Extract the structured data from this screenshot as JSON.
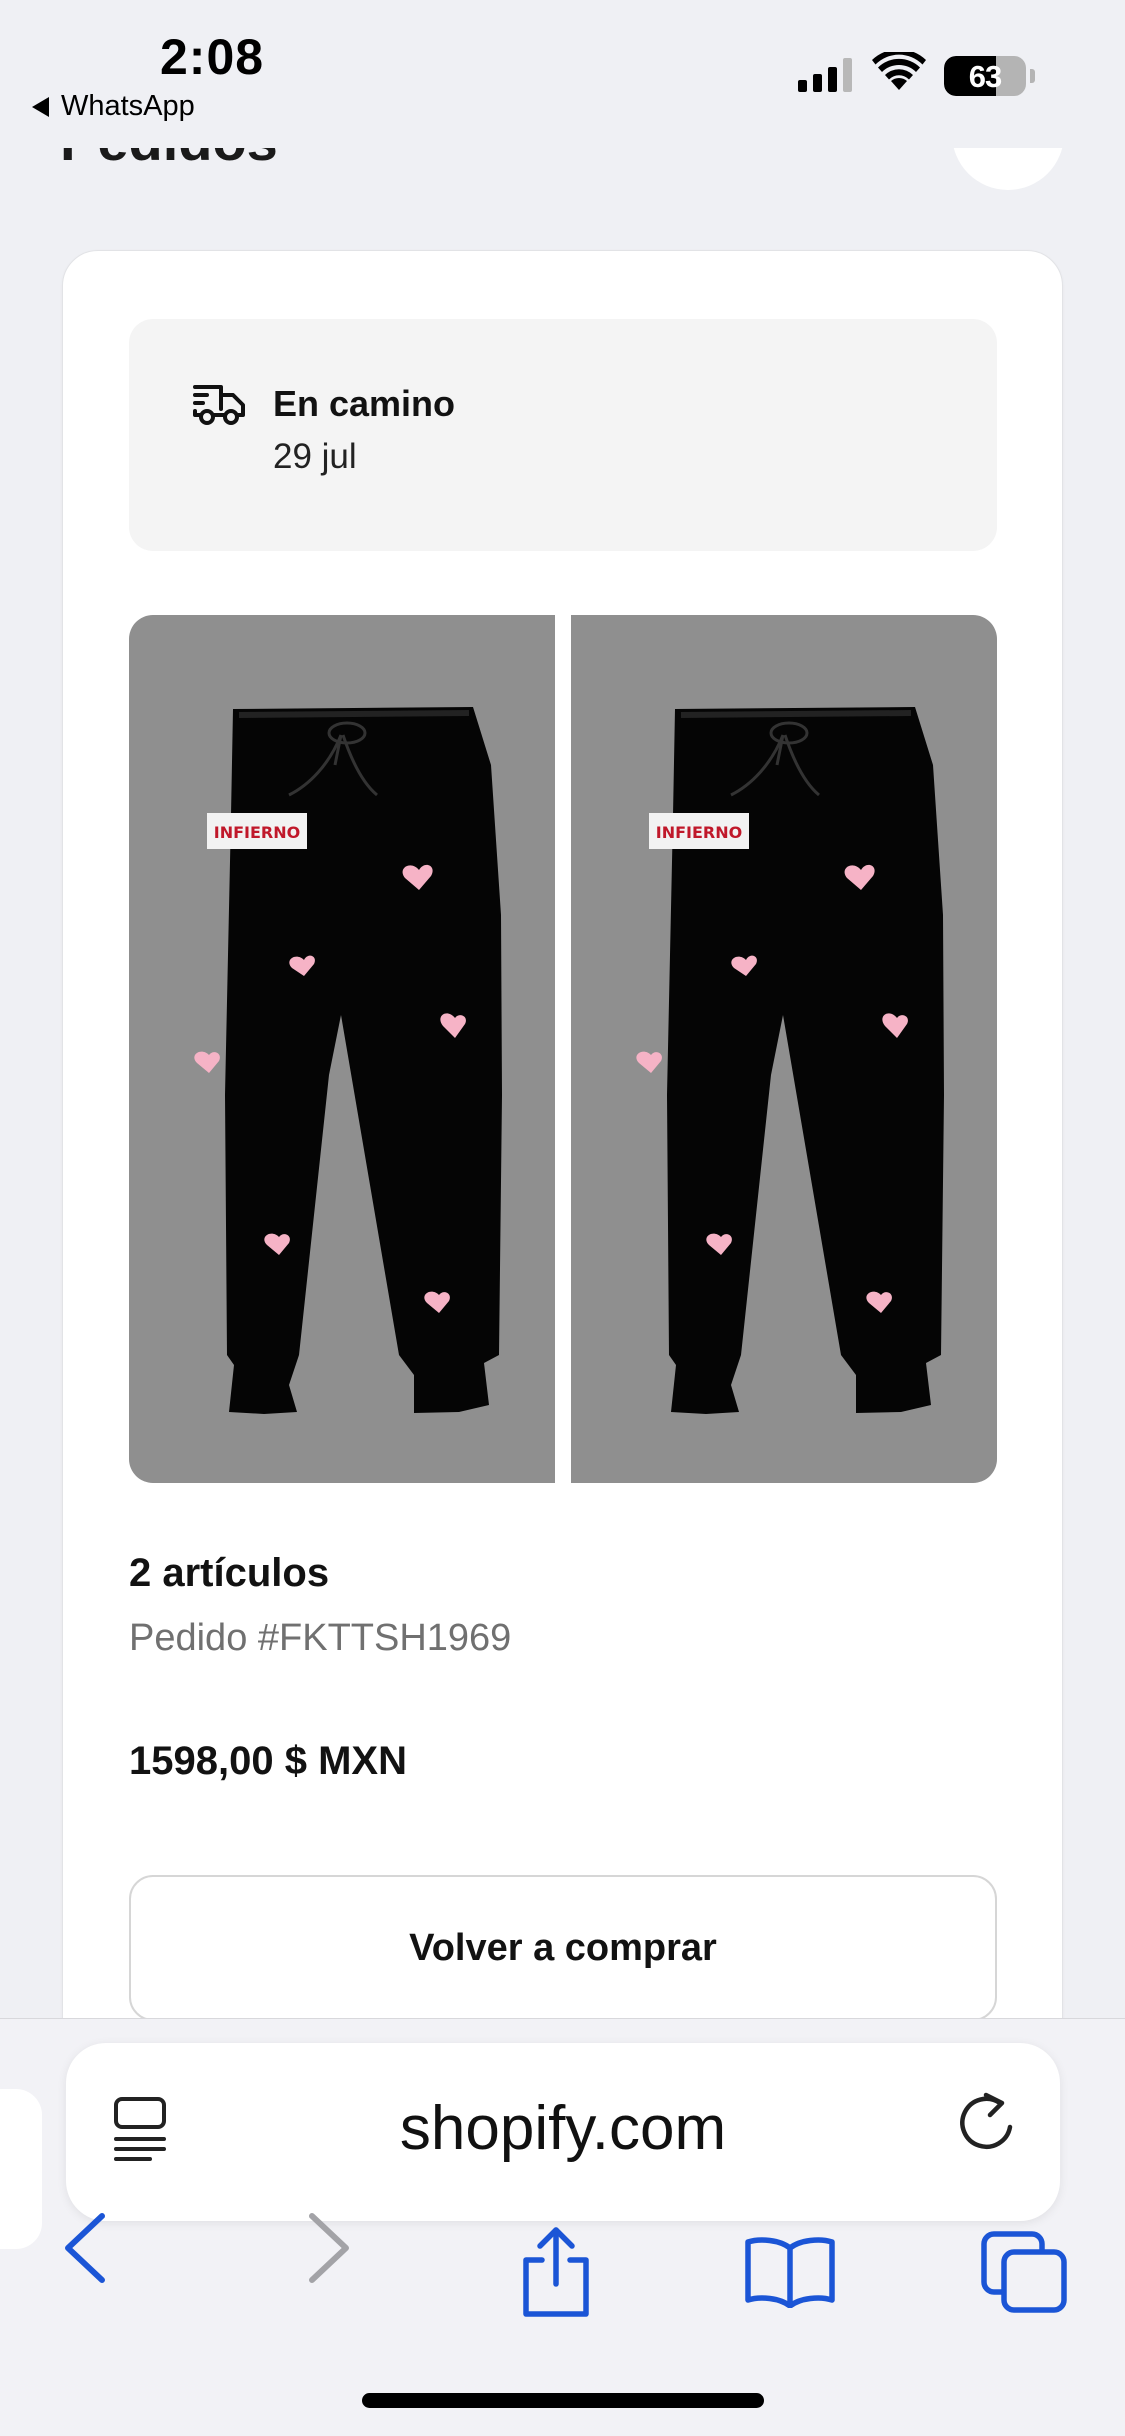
{
  "status_bar": {
    "time": "2:08",
    "back_app": "WhatsApp",
    "battery": "63",
    "battery_level": 0.63
  },
  "page": {
    "title": "Pedidos"
  },
  "order": {
    "status": "En camino",
    "date": "29 jul",
    "items_count": "2 artículos",
    "order_number": "Pedido #FKTTSH1969",
    "total": "1598,00 $ MXN",
    "reorder_label": "Volver a comprar",
    "product_print_text": "INFIERNO"
  },
  "browser": {
    "url": "shopify.com",
    "icons": [
      "reader-icon",
      "reload-icon",
      "back-icon",
      "forward-icon",
      "share-icon",
      "bookmarks-icon",
      "tabs-icon"
    ],
    "accent_color": "#1b55d6"
  }
}
